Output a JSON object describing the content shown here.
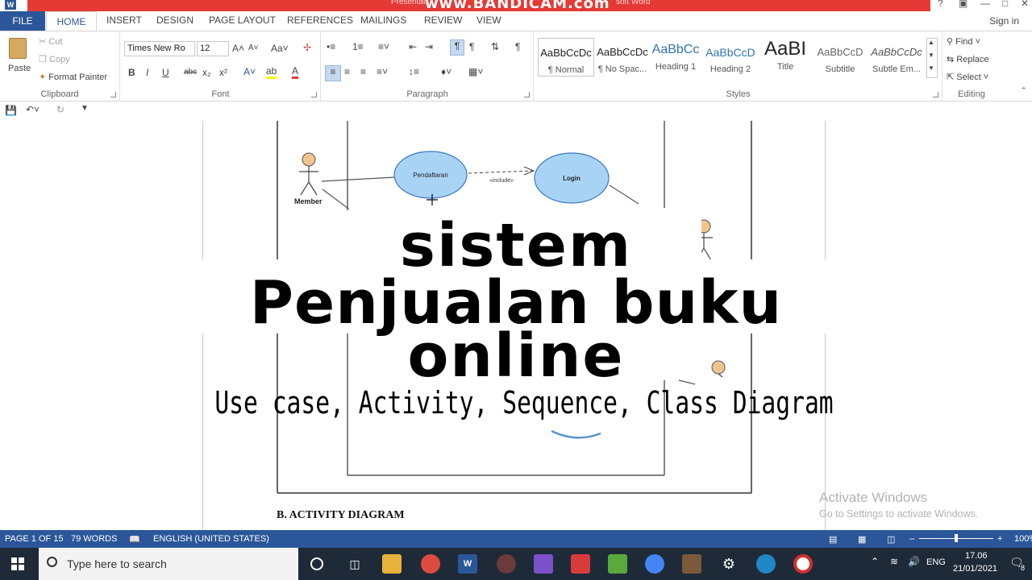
{
  "titlebar": {
    "title_fragment_left": "Presentat",
    "watermark": "www.BANDICAM.com",
    "title_fragment_right": "soft Word",
    "app_icon": "W"
  },
  "tabs": {
    "file": "FILE",
    "items": [
      "HOME",
      "INSERT",
      "DESIGN",
      "PAGE LAYOUT",
      "REFERENCES",
      "MAILINGS",
      "REVIEW",
      "VIEW"
    ],
    "sign_in": "Sign in"
  },
  "clipboard": {
    "paste": "Paste",
    "cut": "Cut",
    "copy": "Copy",
    "format_painter": "Format Painter",
    "label": "Clipboard"
  },
  "font": {
    "name": "Times New Ro",
    "size": "12",
    "label": "Font",
    "buttons": [
      "B",
      "I",
      "U",
      "abc",
      "x₂",
      "x²"
    ]
  },
  "paragraph": {
    "label": "Paragraph"
  },
  "styles": {
    "label": "Styles",
    "items": [
      {
        "sample": "AaBbCcDc",
        "name": "¶ Normal"
      },
      {
        "sample": "AaBbCcDc",
        "name": "¶ No Spac..."
      },
      {
        "sample": "AaBbCc",
        "name": "Heading 1"
      },
      {
        "sample": "AaBbCcD",
        "name": "Heading 2"
      },
      {
        "sample": "AaBI",
        "name": "Title"
      },
      {
        "sample": "AaBbCcD",
        "name": "Subtitle"
      },
      {
        "sample": "AaBbCcDc",
        "name": "Subtle Em..."
      }
    ]
  },
  "editing": {
    "find": "Find",
    "replace": "Replace",
    "select": "Select",
    "label": "Editing"
  },
  "document": {
    "uml": {
      "actor1": "Member",
      "usecase1": "Pendaftaran",
      "usecase2": "Login",
      "relation": "«include»"
    },
    "overlay_line1": "sistem",
    "overlay_line2": "Penjualan buku",
    "overlay_line3": "online",
    "subtitle": "Use case, Activity, Sequence, Class Diagram",
    "section_heading": "B. ACTIVITY DIAGRAM"
  },
  "watermark_windows": {
    "line1": "Activate Windows",
    "line2": "Go to Settings to activate Windows."
  },
  "statusbar": {
    "page": "PAGE 1 OF 15",
    "words": "79 WORDS",
    "language": "ENGLISH (UNITED STATES)",
    "zoom": "100%"
  },
  "taskbar": {
    "search_placeholder": "Type here to search",
    "lang": "ENG",
    "time": "17.06",
    "date": "21/01/2021",
    "notifications": "8"
  },
  "colors": {
    "word_blue": "#2b579a",
    "bandicam_red": "#e53935",
    "taskbar": "#1f2a38",
    "usecase_fill": "#a9d3f5",
    "actor_fill": "#f2c48d"
  }
}
